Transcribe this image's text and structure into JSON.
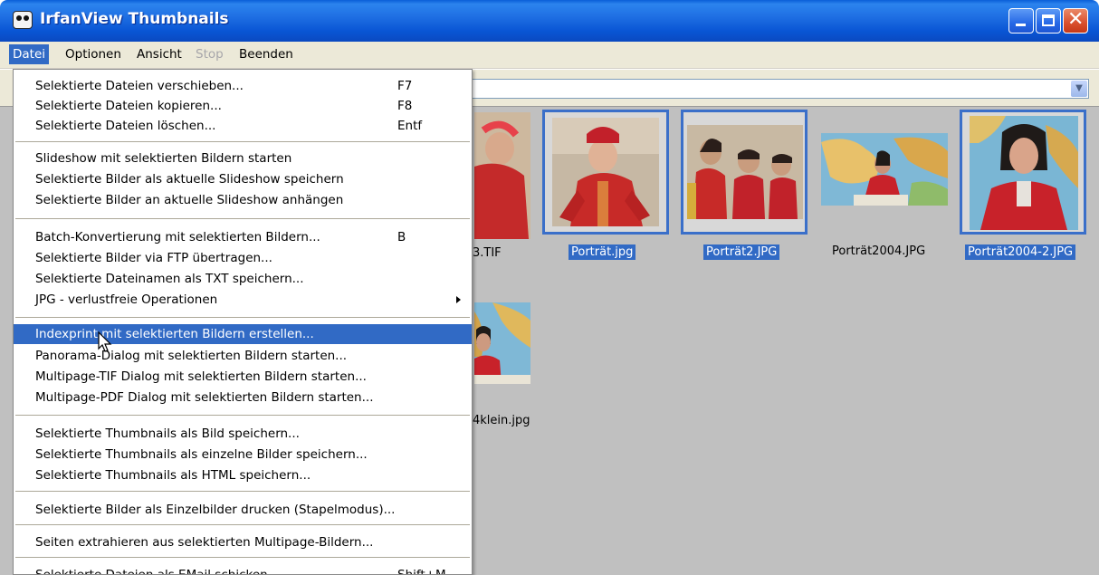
{
  "window": {
    "title": "IrfanView Thumbnails",
    "colors": {
      "titlebar": "#0a5fd8",
      "menu_highlight": "#316ac5",
      "thumb_bg": "#c0c0c0"
    }
  },
  "menubar": {
    "items": [
      "Datei",
      "Optionen",
      "Ansicht",
      "Stop",
      "Beenden"
    ]
  },
  "dropdown": {
    "groups": [
      [
        {
          "label": "Selektierte Dateien verschieben...",
          "key": "F7"
        },
        {
          "label": "Selektierte Dateien kopieren...",
          "key": "F8"
        },
        {
          "label": "Selektierte Dateien löschen...",
          "key": "Entf"
        }
      ],
      [
        {
          "label": "Slideshow mit selektierten Bildern starten",
          "key": ""
        },
        {
          "label": "Selektierte Bilder als aktuelle Slideshow speichern",
          "key": ""
        },
        {
          "label": "Selektierte Bilder an aktuelle Slideshow anhängen",
          "key": ""
        }
      ],
      [
        {
          "label": "Batch-Konvertierung mit selektierten Bildern...",
          "key": "B"
        },
        {
          "label": "Selektierte Bilder via FTP übertragen...",
          "key": ""
        },
        {
          "label": "Selektierte Dateinamen als TXT speichern...",
          "key": ""
        },
        {
          "label": "JPG - verlustfreie Operationen",
          "key": "",
          "submenu": true
        }
      ],
      [
        {
          "label": "Indexprint mit selektierten Bildern erstellen...",
          "key": "",
          "highlighted": true
        },
        {
          "label": "Panorama-Dialog mit selektierten Bildern starten...",
          "key": ""
        },
        {
          "label": "Multipage-TIF Dialog mit selektierten Bildern starten...",
          "key": ""
        },
        {
          "label": "Multipage-PDF Dialog mit selektierten Bildern starten...",
          "key": ""
        }
      ],
      [
        {
          "label": "Selektierte Thumbnails als Bild speichern...",
          "key": ""
        },
        {
          "label": "Selektierte Thumbnails als einzelne Bilder speichern...",
          "key": ""
        },
        {
          "label": "Selektierte Thumbnails als HTML speichern...",
          "key": ""
        }
      ],
      [
        {
          "label": "Selektierte Bilder als Einzelbilder drucken (Stapelmodus)...",
          "key": ""
        }
      ],
      [
        {
          "label": "Seiten extrahieren aus selektierten Multipage-Bildern...",
          "key": ""
        }
      ],
      [
        {
          "label": "Selektierte Dateien als EMail schicken",
          "key": "Shift+M"
        }
      ]
    ]
  },
  "thumbnails": [
    {
      "caption": "3.TIF",
      "selected": false
    },
    {
      "caption": "Porträt.jpg",
      "selected": true
    },
    {
      "caption": "Porträt2.JPG",
      "selected": true
    },
    {
      "caption": "Porträt2004.JPG",
      "selected": false
    },
    {
      "caption": "Porträt2004-2.JPG",
      "selected": true
    },
    {
      "caption": "4klein.jpg",
      "selected": false
    }
  ]
}
